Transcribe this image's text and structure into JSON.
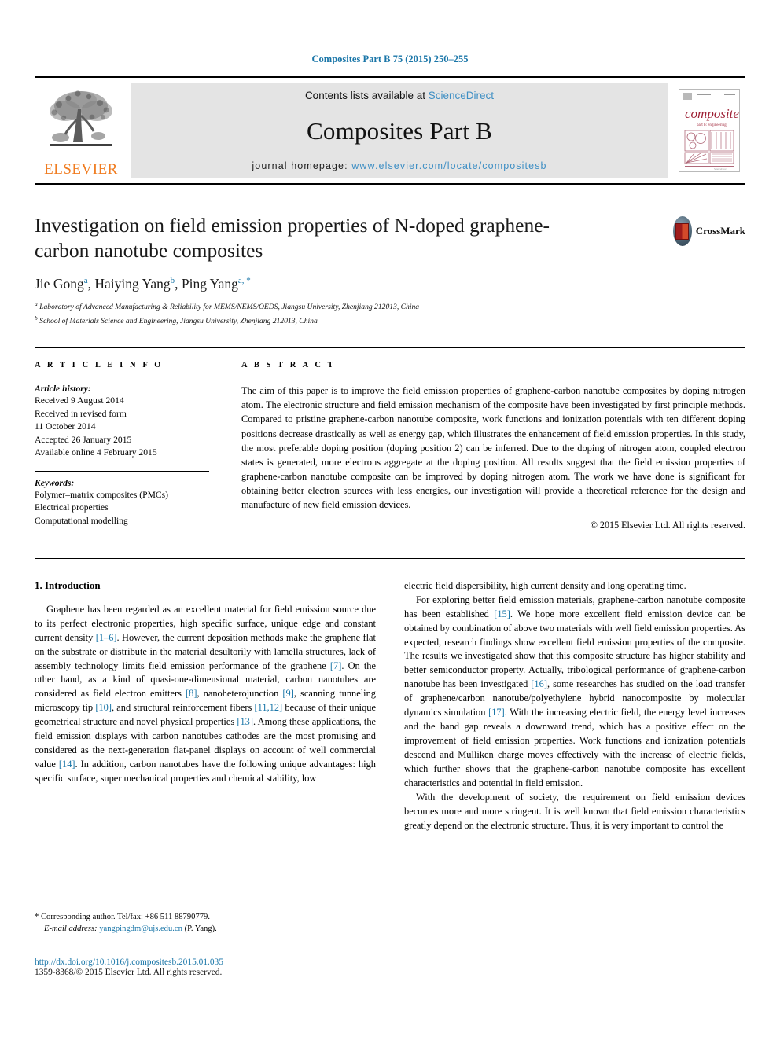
{
  "running_head": "Composites Part B 75 (2015) 250–255",
  "masthead": {
    "publisher_name": "ELSEVIER",
    "contents_prefix": "Contents lists available at ",
    "contents_link": "ScienceDirect",
    "journal_name": "Composites Part B",
    "homepage_prefix": "journal homepage: ",
    "homepage_url": "www.elsevier.com/locate/compositesb",
    "cover_title": "composites",
    "cover_subtitle": "part b: engineering"
  },
  "article": {
    "title": "Investigation on field emission properties of N-doped graphene-carbon nanotube composites",
    "authors_html": "Jie Gong a, Haiying Yang b, Ping Yang a, *",
    "author_list": [
      {
        "name": "Jie Gong",
        "marks": "a"
      },
      {
        "name": "Haiying Yang",
        "marks": "b"
      },
      {
        "name": "Ping Yang",
        "marks": "a, *"
      }
    ],
    "affiliations": [
      {
        "mark": "a",
        "text": "Laboratory of Advanced Manufacturing & Reliability for MEMS/NEMS/OEDS, Jiangsu University, Zhenjiang 212013, China"
      },
      {
        "mark": "b",
        "text": "School of Materials Science and Engineering, Jiangsu University, Zhenjiang 212013, China"
      }
    ],
    "crossmark_label": "CrossMark"
  },
  "article_info": {
    "heading": "A R T I C L E   I N F O",
    "history_label": "Article history:",
    "history": [
      "Received 9 August 2014",
      "Received in revised form",
      "11 October 2014",
      "Accepted 26 January 2015",
      "Available online 4 February 2015"
    ],
    "keywords_label": "Keywords:",
    "keywords": [
      "Polymer–matrix composites (PMCs)",
      "Electrical properties",
      "Computational modelling"
    ]
  },
  "abstract": {
    "heading": "A B S T R A C T",
    "text": "The aim of this paper is to improve the field emission properties of graphene-carbon nanotube composites by doping nitrogen atom. The electronic structure and field emission mechanism of the composite have been investigated by first principle methods. Compared to pristine graphene-carbon nanotube composite, work functions and ionization potentials with ten different doping positions decrease drastically as well as energy gap, which illustrates the enhancement of field emission properties. In this study, the most preferable doping position (doping position 2) can be inferred. Due to the doping of nitrogen atom, coupled electron states is generated, more electrons aggregate at the doping position. All results suggest that the field emission properties of graphene-carbon nanotube composite can be improved by doping nitrogen atom. The work we have done is significant for obtaining better electron sources with less energies, our investigation will provide a theoretical reference for the design and manufacture of new field emission devices.",
    "copyright": "© 2015 Elsevier Ltd. All rights reserved."
  },
  "body": {
    "section_heading": "1. Introduction",
    "left_paragraphs": [
      "Graphene has been regarded as an excellent material for field emission source due to its perfect electronic properties, high specific surface, unique edge and constant current density [1–6]. However, the current deposition methods make the graphene flat on the substrate or distribute in the material desultorily with lamella structures, lack of assembly technology limits field emission performance of the graphene [7]. On the other hand, as a kind of quasi-one-dimensional material, carbon nanotubes are considered as field electron emitters [8], nanoheterojunction [9], scanning tunneling microscopy tip [10], and structural reinforcement fibers [11,12] because of their unique geometrical structure and novel physical properties [13]. Among these applications, the field emission displays with carbon nanotubes cathodes are the most promising and considered as the next-generation flat-panel displays on account of well commercial value [14]. In addition, carbon nanotubes have the following unique advantages: high specific surface, super mechanical properties and chemical stability, low"
    ],
    "right_paragraphs": [
      "electric field dispersibility, high current density and long operating time.",
      "For exploring better field emission materials, graphene-carbon nanotube composite has been established [15]. We hope more excellent field emission device can be obtained by combination of above two materials with well field emission properties. As expected, research findings show excellent field emission properties of the composite. The results we investigated show that this composite structure has higher stability and better semiconductor property. Actually, tribological performance of graphene-carbon nanotube has been investigated [16], some researches has studied on the load transfer of graphene/carbon nanotube/polyethylene hybrid nanocomposite by molecular dynamics simulation [17]. With the increasing electric field, the energy level increases and the band gap reveals a downward trend, which has a positive effect on the improvement of field emission properties. Work functions and ionization potentials descend and Mulliken charge moves effectively with the increase of electric fields, which further shows that the graphene-carbon nanotube composite has excellent characteristics and potential in field emission.",
      "With the development of society, the requirement on field emission devices becomes more and more stringent. It is well known that field emission characteristics greatly depend on the electronic structure. Thus, it is very important to control the"
    ]
  },
  "footer": {
    "corresponding_marker": "*",
    "corresponding_text": "Corresponding author. Tel/fax: +86 511 88790779.",
    "email_label": "E-mail address:",
    "email": "yangpingdm@ujs.edu.cn",
    "email_suffix": "(P. Yang).",
    "doi": "http://dx.doi.org/10.1016/j.compositesb.2015.01.035",
    "issn": "1359-8368/© 2015 Elsevier Ltd. All rights reserved."
  },
  "colors": {
    "link_blue": "#1a76a8",
    "elsevier_orange": "#f07c20",
    "masthead_gray": "#e4e4e4",
    "cover_red": "#9e2236"
  }
}
